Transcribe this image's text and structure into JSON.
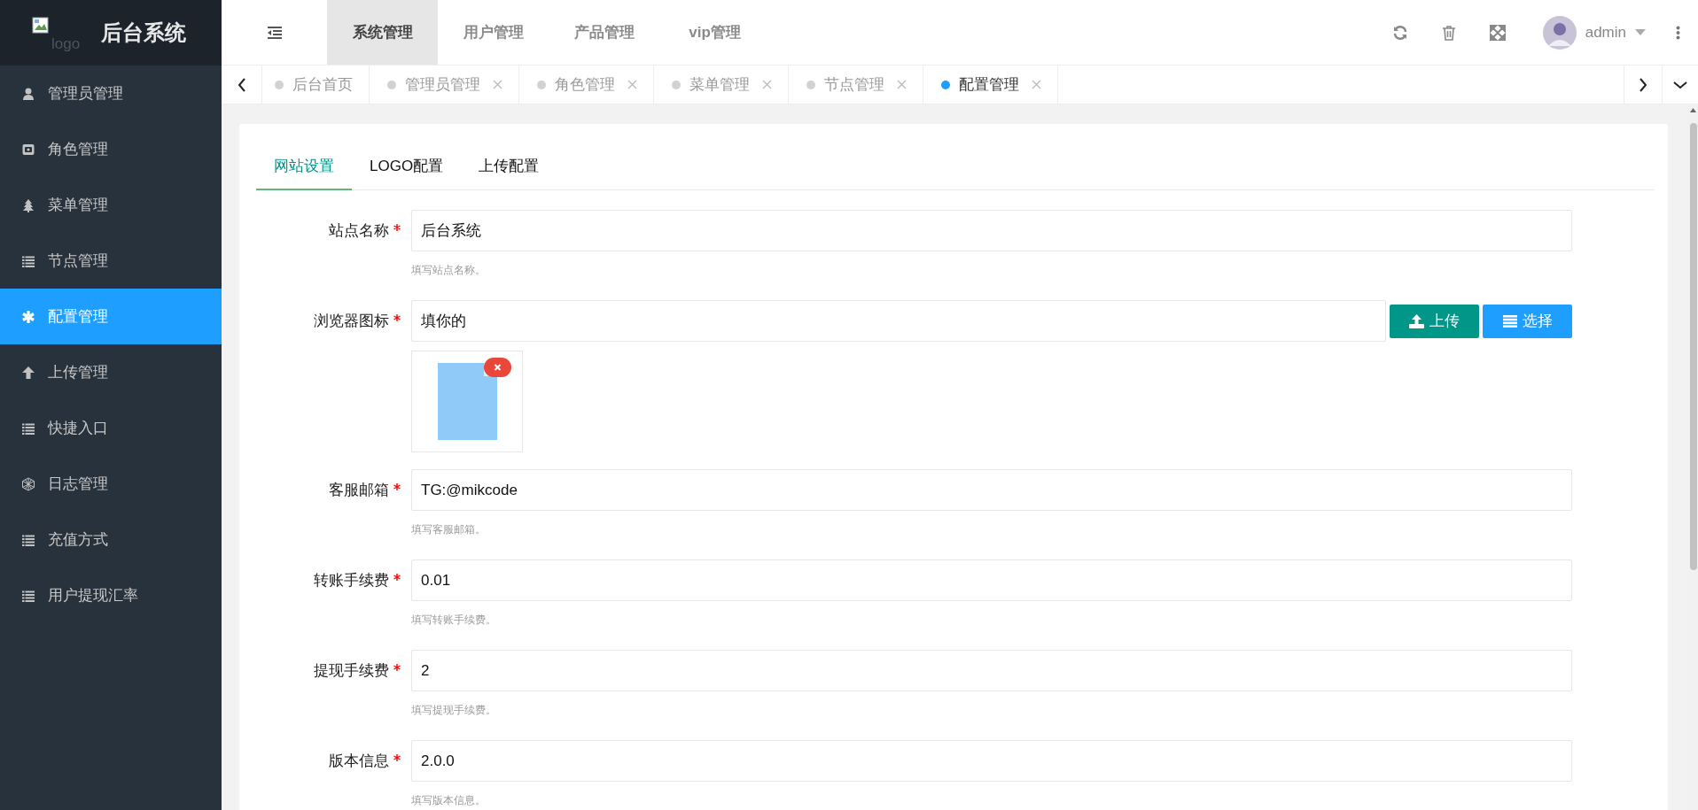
{
  "logo": {
    "alt": "logo",
    "title": "后台系统"
  },
  "sidebar": {
    "items": [
      {
        "label": "管理员管理",
        "selected": false
      },
      {
        "label": "角色管理",
        "selected": false
      },
      {
        "label": "菜单管理",
        "selected": false
      },
      {
        "label": "节点管理",
        "selected": false
      },
      {
        "label": "配置管理",
        "selected": true
      },
      {
        "label": "上传管理",
        "selected": false
      },
      {
        "label": "快捷入口",
        "selected": false
      },
      {
        "label": "日志管理",
        "selected": false
      },
      {
        "label": "充值方式",
        "selected": false
      },
      {
        "label": "用户提现汇率",
        "selected": false
      }
    ]
  },
  "top_menu": [
    {
      "label": "系统管理",
      "selected": true
    },
    {
      "label": "用户管理",
      "selected": false
    },
    {
      "label": "产品管理",
      "selected": false
    },
    {
      "label": "vip管理",
      "selected": false
    }
  ],
  "user": {
    "name": "admin"
  },
  "page_tabs": [
    {
      "label": "后台首页",
      "selected": false,
      "closable": false
    },
    {
      "label": "管理员管理",
      "selected": false,
      "closable": true
    },
    {
      "label": "角色管理",
      "selected": false,
      "closable": true
    },
    {
      "label": "菜单管理",
      "selected": false,
      "closable": true
    },
    {
      "label": "节点管理",
      "selected": false,
      "closable": true
    },
    {
      "label": "配置管理",
      "selected": true,
      "closable": true
    }
  ],
  "settings_tabs": [
    {
      "label": "网站设置",
      "selected": true
    },
    {
      "label": "LOGO配置",
      "selected": false
    },
    {
      "label": "上传配置",
      "selected": false
    }
  ],
  "form": {
    "fields": [
      {
        "kind": "text",
        "label": "站点名称",
        "required": true,
        "value": "后台系统",
        "hint": "填写站点名称。"
      },
      {
        "kind": "upload",
        "label": "浏览器图标",
        "required": true,
        "value": "填你的",
        "buttons": [
          {
            "kind": "upload",
            "label": "上传"
          },
          {
            "kind": "select",
            "label": "选择"
          }
        ]
      },
      {
        "kind": "text",
        "label": "客服邮箱",
        "required": true,
        "value": "TG:@mikcode",
        "hint": "填写客服邮箱。"
      },
      {
        "kind": "text",
        "label": "转账手续费",
        "required": true,
        "value": "0.01",
        "hint": "填写转账手续费。"
      },
      {
        "kind": "text",
        "label": "提现手续费",
        "required": true,
        "value": "2",
        "hint": "填写提现手续费。"
      },
      {
        "kind": "text",
        "label": "版本信息",
        "required": true,
        "value": "2.0.0",
        "hint": "填写版本信息。"
      }
    ]
  }
}
